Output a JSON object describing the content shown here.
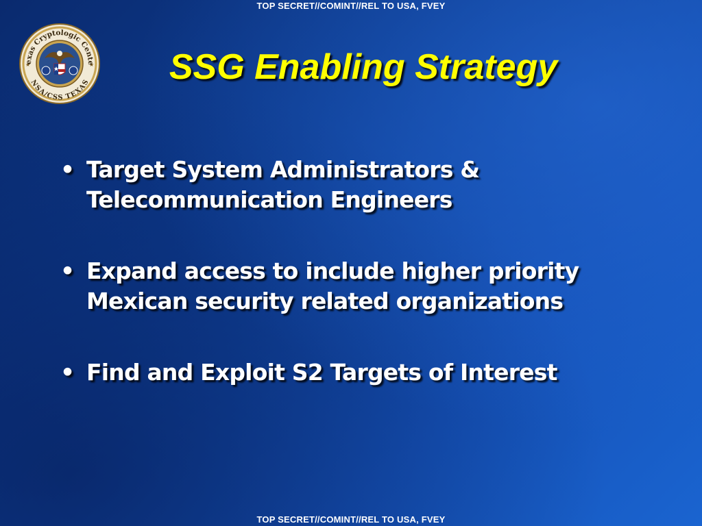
{
  "classification": {
    "top": "TOP SECRET//COMINT//REL TO USA, FVEY",
    "bottom": "TOP SECRET//COMINT//REL TO USA, FVEY"
  },
  "seal": {
    "arc_top": "Texas Cryptologic Center",
    "arc_bottom": "NSA/CSS TEXAS",
    "icon": "agency-seal-icon",
    "colors": {
      "ring": "#c9a552",
      "inner": "#2a4f8e",
      "outer": "#f2ead6"
    }
  },
  "title": "SSG Enabling Strategy",
  "bullets": [
    {
      "marker": "•",
      "text": "Target System Administrators & Telecommunication Engineers"
    },
    {
      "marker": "•",
      "text": "Expand access to include higher priority Mexican security related organizations"
    },
    {
      "marker": "•",
      "text": "Find and Exploit S2 Targets of Interest"
    }
  ],
  "colors": {
    "background": "#0d3b8f",
    "title": "#ffff00",
    "text": "#ffffff"
  }
}
